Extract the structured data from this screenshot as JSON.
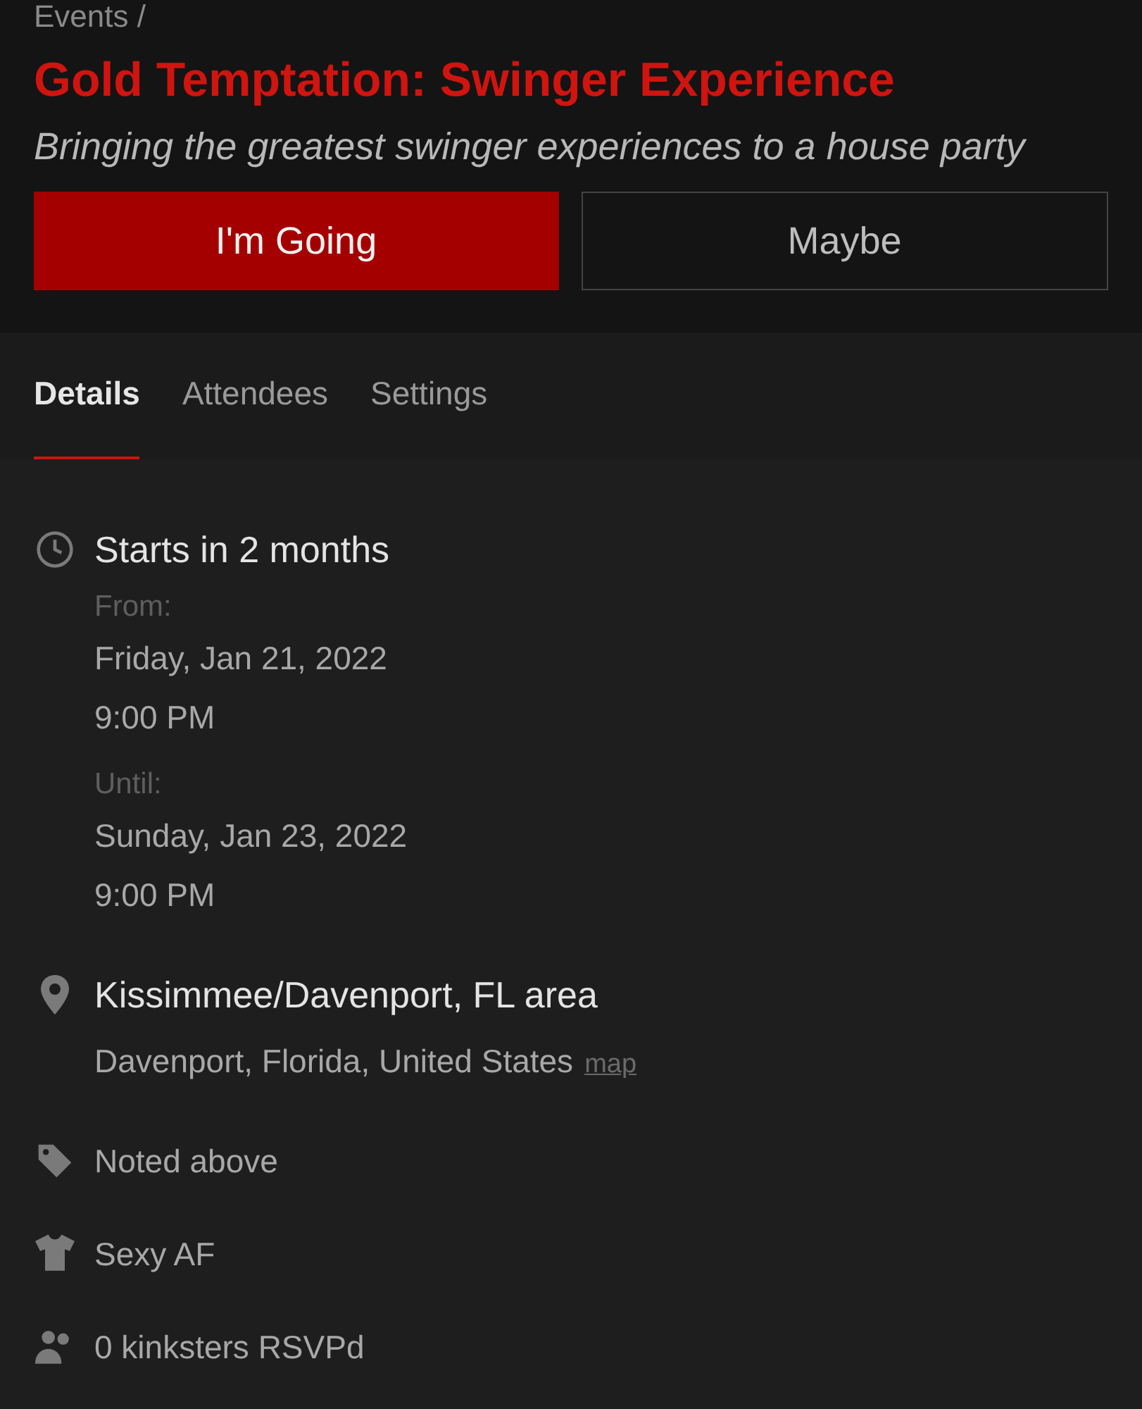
{
  "breadcrumb": "Events /",
  "title": "Gold Temptation: Swinger Experience",
  "subtitle": "Bringing the greatest swinger experiences to a house party",
  "rsvp_buttons": [
    {
      "label": "I'm Going",
      "selected": true
    },
    {
      "label": "Maybe",
      "selected": false
    }
  ],
  "tabs": [
    {
      "label": "Details",
      "selected": true
    },
    {
      "label": "Attendees",
      "selected": false
    },
    {
      "label": "Settings",
      "selected": false
    }
  ],
  "details": [
    {
      "kind": "clock",
      "heading": "Starts in 2 months",
      "lines": [
        {
          "kind": "label",
          "text": "From:"
        },
        {
          "kind": "value",
          "text": "Friday, Jan 21, 2022"
        },
        {
          "kind": "value",
          "text": "9:00 PM"
        },
        {
          "kind": "label",
          "text": "Until:"
        },
        {
          "kind": "value",
          "text": "Sunday, Jan 23, 2022"
        },
        {
          "kind": "value",
          "text": "9:00 PM"
        }
      ]
    },
    {
      "kind": "pin",
      "heading": "Kissimmee/Davenport, FL area",
      "lines": [
        {
          "kind": "value",
          "text": "Davenport, Florida, United States",
          "link": "map"
        }
      ]
    },
    {
      "kind": "tag",
      "heading": "Noted above"
    },
    {
      "kind": "shirt",
      "heading": "Sexy AF"
    },
    {
      "kind": "people",
      "heading": "0 kinksters RSVPd"
    }
  ]
}
